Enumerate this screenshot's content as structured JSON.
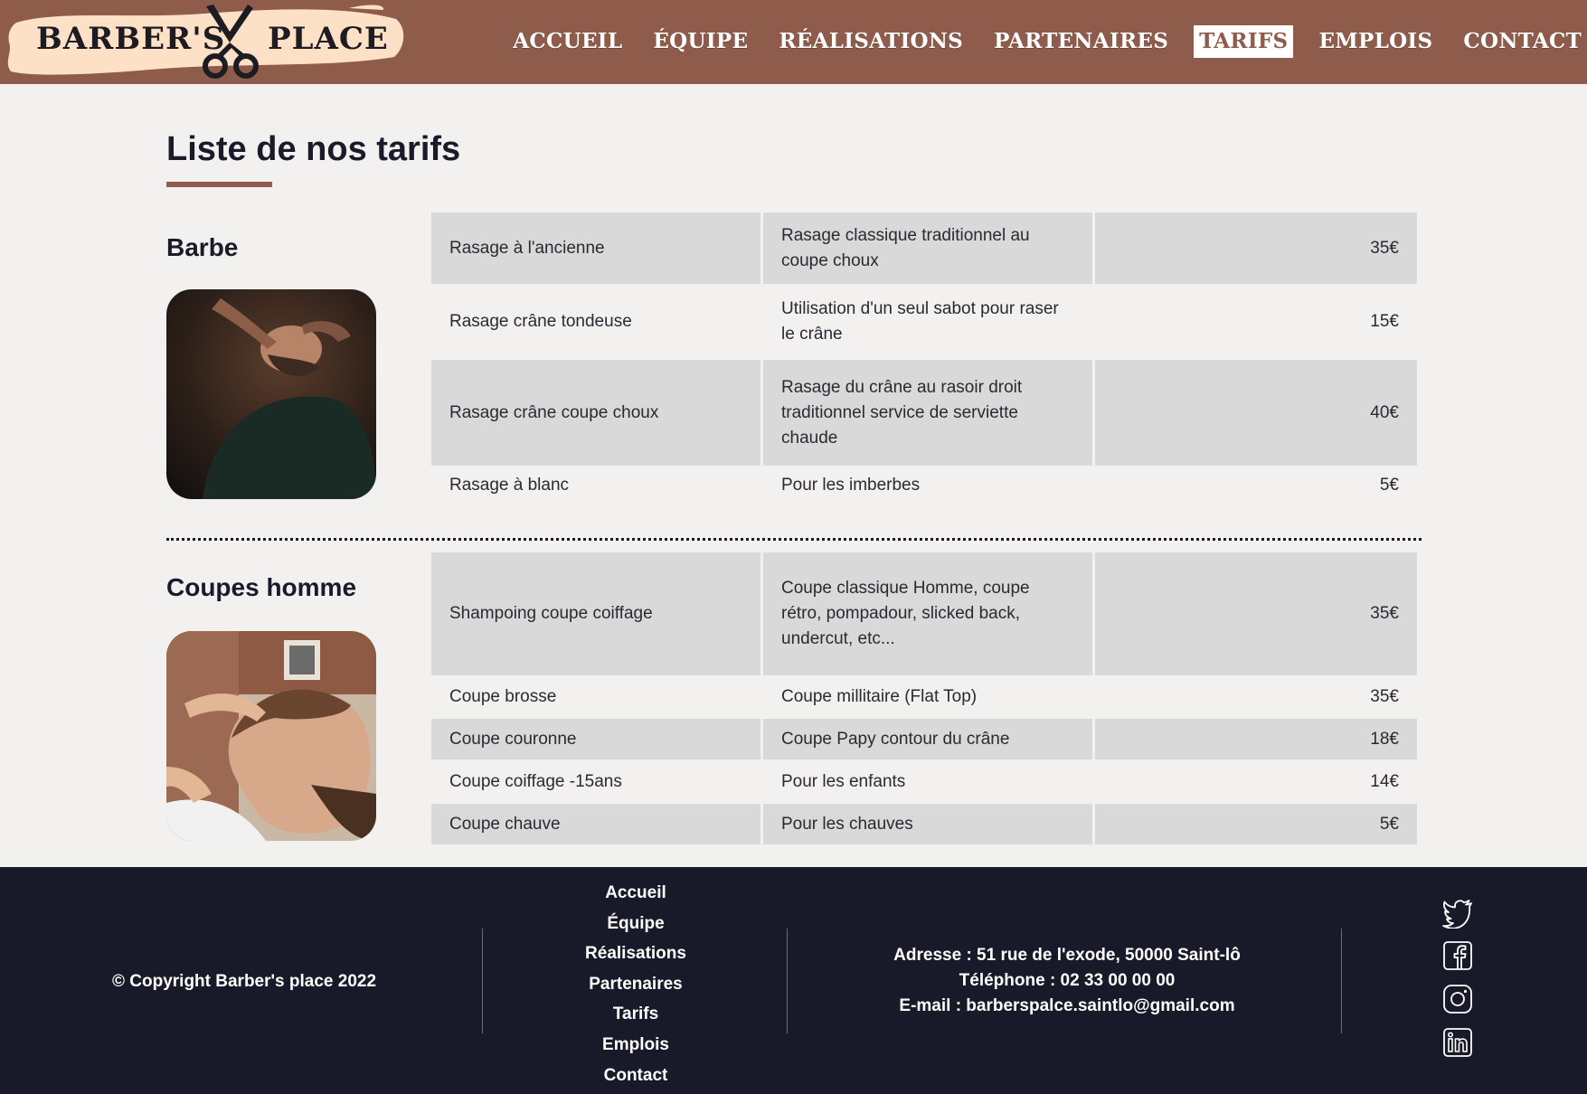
{
  "brand": {
    "left_word": "BARBER'S",
    "right_word": "PLACE",
    "logo_icon": "scissors-icon",
    "header_color": "#8f5c4b",
    "logo_bg_color": "#fde1c6"
  },
  "nav": {
    "items": [
      {
        "label": "ACCUEIL",
        "active": false
      },
      {
        "label": "ÉQUIPE",
        "active": false
      },
      {
        "label": "RÉALISATIONS",
        "active": false
      },
      {
        "label": "PARTENAIRES",
        "active": false
      },
      {
        "label": "TARIFS",
        "active": true
      },
      {
        "label": "EMPLOIS",
        "active": false
      },
      {
        "label": "CONTACT",
        "active": false
      }
    ]
  },
  "main": {
    "title": "Liste de nos tarifs",
    "sections": [
      {
        "title": "Barbe",
        "image": "man-getting-beard-shaved-photo",
        "rows": [
          {
            "name": "Rasage à l'ancienne",
            "desc": "Rasage classique traditionnel au coupe choux",
            "price": "35€"
          },
          {
            "name": "Rasage crâne tondeuse",
            "desc": "Utilisation d'un seul sabot pour raser le crâne",
            "price": "15€"
          },
          {
            "name": "Rasage crâne coupe choux",
            "desc": "Rasage du crâne au rasoir droit traditionnel service de serviette chaude",
            "price": "40€"
          },
          {
            "name": "Rasage à blanc",
            "desc": "Pour les imberbes",
            "price": "5€"
          }
        ]
      },
      {
        "title": "Coupes homme",
        "image": "man-getting-haircut-photo",
        "rows": [
          {
            "name": "Shampoing coupe coiffage",
            "desc": "Coupe classique Homme, coupe rétro, pompadour, slicked back, undercut, etc...",
            "price": "35€"
          },
          {
            "name": "Coupe brosse",
            "desc": "Coupe millitaire (Flat Top)",
            "price": "35€"
          },
          {
            "name": "Coupe couronne",
            "desc": "Coupe Papy contour du crâne",
            "price": "18€"
          },
          {
            "name": "Coupe coiffage -15ans",
            "desc": "Pour les enfants",
            "price": "14€"
          },
          {
            "name": "Coupe chauve",
            "desc": "Pour les chauves",
            "price": "5€"
          }
        ]
      }
    ]
  },
  "footer": {
    "copyright": "© Copyright Barber's place 2022",
    "links": [
      "Accueil",
      "Équipe",
      "Réalisations",
      "Partenaires",
      "Tarifs",
      "Emplois",
      "Contact"
    ],
    "contact": {
      "address": "Adresse : 51 rue de l'exode, 50000 Saint-lô",
      "phone": "Téléphone : 02 33 00 00 00",
      "email": "E-mail : barberspalce.saintlo@gmail.com"
    },
    "socials": [
      "twitter-icon",
      "facebook-icon",
      "instagram-icon",
      "linkedin-icon"
    ],
    "bg_color": "#191a29"
  }
}
